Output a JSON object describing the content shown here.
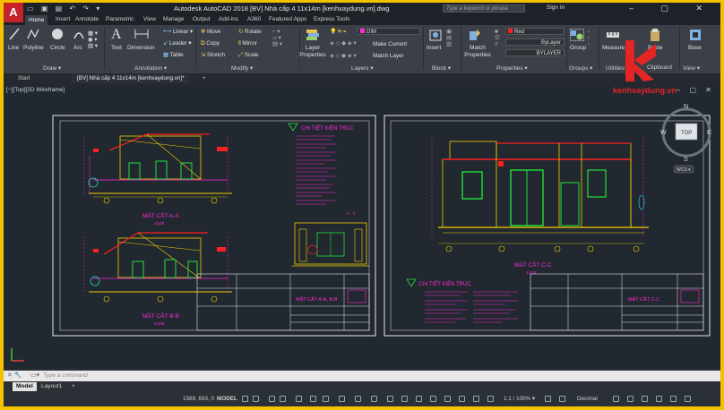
{
  "window": {
    "title": "Autodesk AutoCAD 2018    [BV] Nhà cấp 4 11x14m [kenhxaydung.vn].dwg",
    "search_placeholder": "Type a keyword or phrase",
    "sign_in": "Sign In",
    "logo_letter": "A"
  },
  "ribbon_tabs": [
    "Home",
    "Insert",
    "Annotate",
    "Parametric",
    "View",
    "Manage",
    "Output",
    "Add-ins",
    "A360",
    "Featured Apps",
    "Express Tools"
  ],
  "draw_panel": {
    "line": "Line",
    "polyline": "Polyline",
    "circle": "Circle",
    "arc": "Arc",
    "label": "Draw ▾"
  },
  "annotation_panel": {
    "text": "Text",
    "dimension": "Dimension",
    "linear": "Linear ▾",
    "leader": "Leader ▾",
    "table": "Table",
    "label": "Annotation ▾"
  },
  "modify_panel": {
    "move": "Move",
    "rotate": "Rotate",
    "copy": "Copy",
    "mirror": "Mirror",
    "stretch": "Stretch",
    "scale": "Scale",
    "label": "Modify ▾"
  },
  "layers_panel": {
    "layer_properties": "Layer Properties",
    "current_layer": "DIM",
    "make_current": "Make Current",
    "match_layer": "Match Layer",
    "label": "Layers ▾"
  },
  "block_panel": {
    "insert": "Insert",
    "label": "Block ▾"
  },
  "properties_panel": {
    "match_properties": "Match Properties",
    "color": "Red",
    "linetype": "ByLayer",
    "lineweight": "BYLAYER",
    "label": "Properties ▾"
  },
  "groups_panel": {
    "group": "Group",
    "label": "Groups ▾"
  },
  "utilities_panel": {
    "measure": "Measure",
    "label": "Utilities ▾"
  },
  "clipboard_panel": {
    "paste": "Paste",
    "label": "Clipboard"
  },
  "view_panel": {
    "base": "Base",
    "label": "View ▾"
  },
  "doc_tabs": {
    "start": "Start",
    "file": "[BV] Nhà cấp 4 11x14m [kenhxaydung.vn]*",
    "add": "+"
  },
  "viewport": {
    "label": "[−][Top][2D Wireframe]",
    "viewcube_top": "TOP",
    "n": "N",
    "s": "S",
    "e": "E",
    "w": "W",
    "wcs": "WCS ▾"
  },
  "drawing": {
    "left_sheet": {
      "notes_title": "CHI TIẾT KIẾN TRÚC",
      "section_a": "MẶT CẮT A-A",
      "section_b": "MẶT CẮT B-B",
      "scale": "1/100",
      "detail_label": "II - II",
      "title_block": "MẶT CẮT A-A, B-B"
    },
    "right_sheet": {
      "section_c": "MẶT CẮT C-C",
      "scale": "1/100",
      "notes_title": "CHI TIẾT KIẾN TRÚC",
      "title_block": "MẶT CẮT C-C"
    }
  },
  "watermark": "kenhxaydung.vn",
  "command": {
    "placeholder": "Type a command"
  },
  "layout_tabs": [
    "Model",
    "Layout1",
    "+"
  ],
  "status": {
    "coords": "1569, 693, 0",
    "model": "MODEL",
    "scale": "1:1 / 100% ▾",
    "units": "Decimal"
  },
  "colors": {
    "accent_red": "#c4232c",
    "drawing_bg": "#212830",
    "yellow": "#f2c200",
    "magenta": "#ff2bd6",
    "green": "#22e03a",
    "cyan": "#2ee6e6"
  }
}
